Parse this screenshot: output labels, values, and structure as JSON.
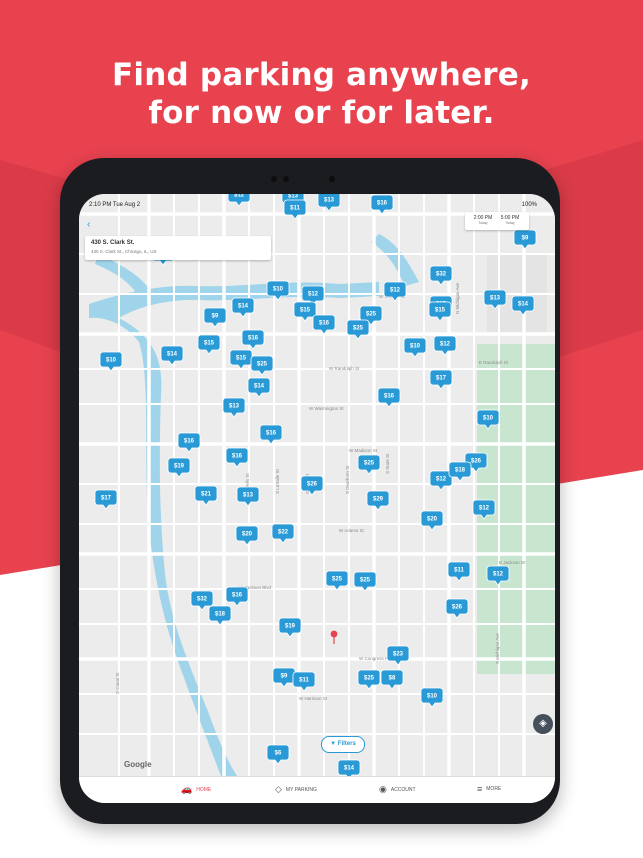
{
  "headline": {
    "line1": "Find parking anywhere,",
    "line2": "for now or for later."
  },
  "colors": {
    "brand_red": "#e8424f",
    "dark_red": "#d83a47",
    "pin_blue": "#2a9ad7",
    "water": "#9fd4ea",
    "park": "#c8e6cf"
  },
  "device": {
    "status": {
      "time": "2:10 PM   Tue Aug 2",
      "battery": "100%"
    },
    "search": {
      "title": "430 S. Clark St.",
      "subtitle": "430 S. Clark St., Chicago, IL, US"
    },
    "times": {
      "start": "2:00 PM",
      "start_day": "Today",
      "end": "5:00 PM",
      "end_day": "Today"
    },
    "filters_label": "Filters",
    "google_label": "Google",
    "tabs": [
      {
        "label": "HOME",
        "icon": "car-icon"
      },
      {
        "label": "MY PARKING",
        "icon": "ticket-icon"
      },
      {
        "label": "ACCOUNT",
        "icon": "person-icon"
      },
      {
        "label": "MORE",
        "icon": "menu-icon"
      }
    ]
  },
  "streets": [
    "W Wacker Dr",
    "W Randolph St",
    "W Washington St",
    "W Madison St",
    "W Adams St",
    "W Jackson Blvd",
    "W Congress Pkwy",
    "W Harrison St",
    "N Michigan Ave",
    "S Michigan Ave",
    "S State St",
    "S Dearborn St",
    "S Clark St",
    "S LaSalle St",
    "S Wells St",
    "S Canal St",
    "E Jackson Dr",
    "E Randolph St"
  ],
  "pins": [
    {
      "label": "$12"
    },
    {
      "label": "$13"
    },
    {
      "label": "$11"
    },
    {
      "label": "$13"
    },
    {
      "label": "$16"
    },
    {
      "label": "$13"
    },
    {
      "label": "$10"
    },
    {
      "label": "$12"
    },
    {
      "label": "$12"
    },
    {
      "label": "$13"
    },
    {
      "label": "$32"
    },
    {
      "label": "$9"
    },
    {
      "label": "$14"
    },
    {
      "label": "$15"
    },
    {
      "label": "$16"
    },
    {
      "label": "$25"
    },
    {
      "label": "$25"
    },
    {
      "label": "$15"
    },
    {
      "label": "$14"
    },
    {
      "label": "$15"
    },
    {
      "label": "$16"
    },
    {
      "label": "$10"
    },
    {
      "label": "$14"
    },
    {
      "label": "$15"
    },
    {
      "label": "$25"
    },
    {
      "label": "$10"
    },
    {
      "label": "$12"
    },
    {
      "label": "$14"
    },
    {
      "label": "$17"
    },
    {
      "label": "$13"
    },
    {
      "label": "$16"
    },
    {
      "label": "$10"
    },
    {
      "label": "$16"
    },
    {
      "label": "$16"
    },
    {
      "label": "$16"
    },
    {
      "label": "$25"
    },
    {
      "label": "$26"
    },
    {
      "label": "$19"
    },
    {
      "label": "$26"
    },
    {
      "label": "$12"
    },
    {
      "label": "$18"
    },
    {
      "label": "$17"
    },
    {
      "label": "$21"
    },
    {
      "label": "$13"
    },
    {
      "label": "$29"
    },
    {
      "label": "$12"
    },
    {
      "label": "$20"
    },
    {
      "label": "$22"
    },
    {
      "label": "$20"
    },
    {
      "label": "$11"
    },
    {
      "label": "$12"
    },
    {
      "label": "$25"
    },
    {
      "label": "$25"
    },
    {
      "label": "$32"
    },
    {
      "label": "$16"
    },
    {
      "label": "$18"
    },
    {
      "label": "$26"
    },
    {
      "label": "$19"
    },
    {
      "label": "$23"
    },
    {
      "label": "$9"
    },
    {
      "label": "$11"
    },
    {
      "label": "$25"
    },
    {
      "label": "$8"
    },
    {
      "label": "$10"
    },
    {
      "label": "$6"
    },
    {
      "label": "$14"
    },
    {
      "label": "$9"
    },
    {
      "label": "$15"
    }
  ]
}
